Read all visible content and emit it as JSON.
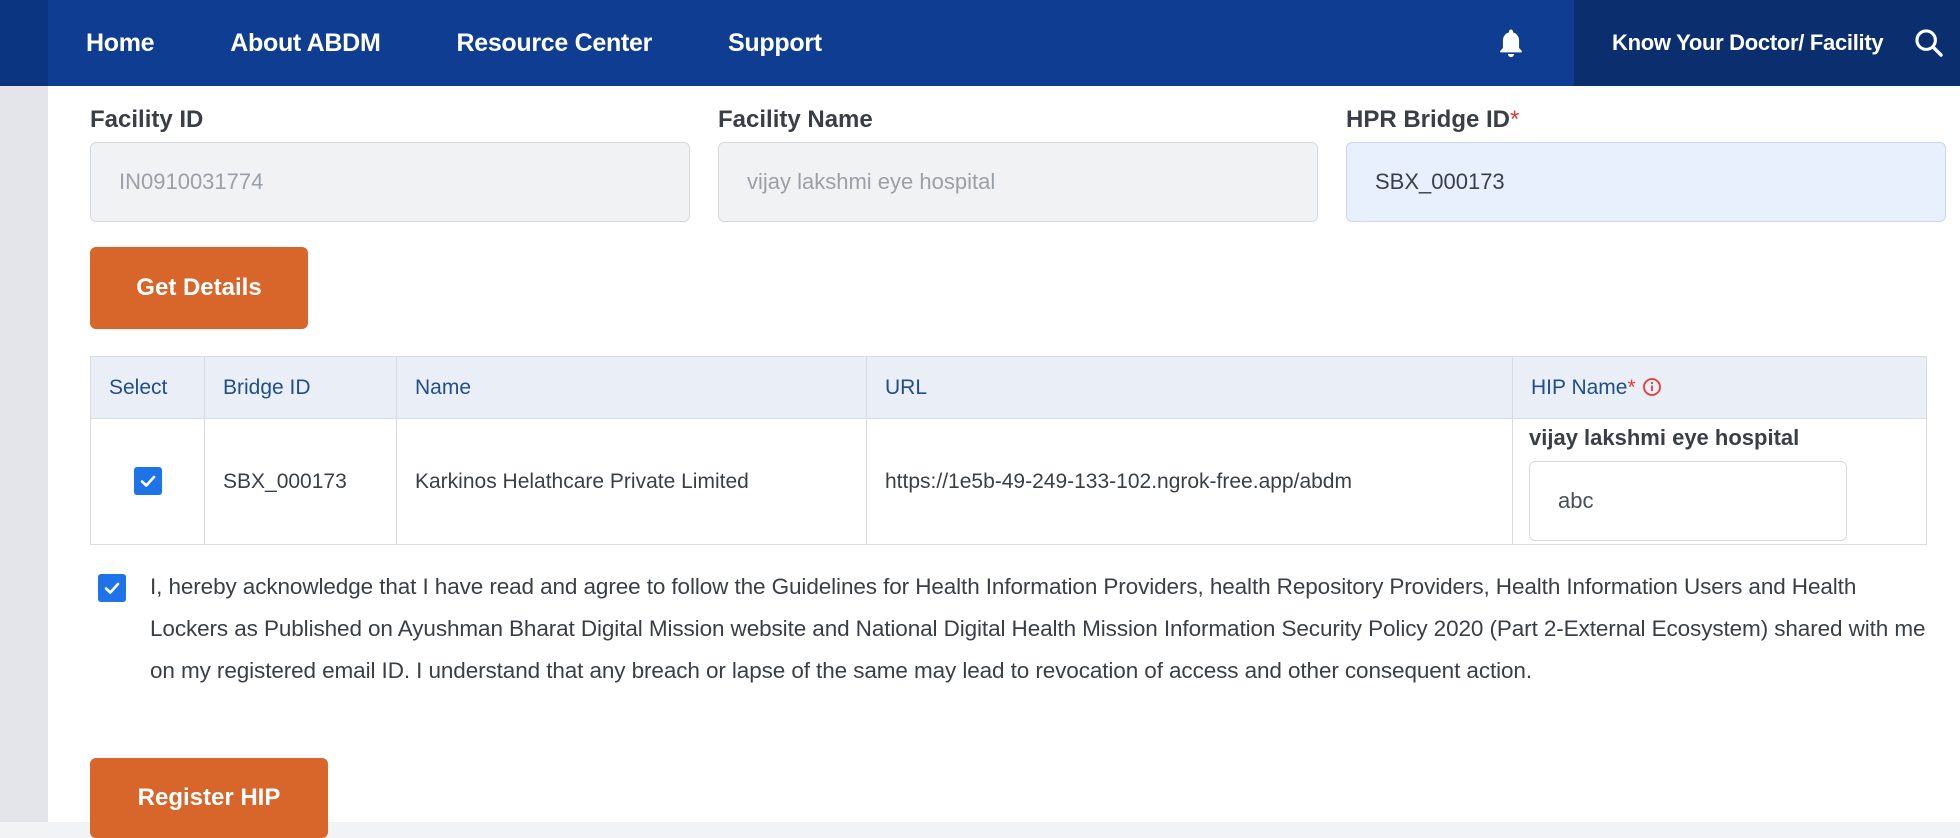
{
  "nav": {
    "items": [
      "Home",
      "About ABDM",
      "Resource Center",
      "Support"
    ],
    "know_label": "Know Your Doctor/ Facility",
    "bell_icon": "bell-icon",
    "search_icon": "search-icon"
  },
  "form": {
    "facility_id_label": "Facility ID",
    "facility_id_value": "IN0910031774",
    "facility_name_label": "Facility Name",
    "facility_name_value": "vijay lakshmi eye hospital",
    "bridge_id_label": "HPR Bridge ID",
    "bridge_id_required": "*",
    "bridge_id_value": "SBX_000173",
    "get_details_label": "Get Details"
  },
  "table": {
    "headers": [
      "Select",
      "Bridge ID",
      "Name",
      "URL",
      "HIP Name"
    ],
    "hip_required": "*",
    "row": {
      "selected": true,
      "bridge_id": "SBX_000173",
      "name": "Karkinos Helathcare Private Limited",
      "url": "https://1e5b-49-249-133-102.ngrok-free.app/abdm",
      "hip_name": "vijay lakshmi eye hospital",
      "hip_input": "abc"
    }
  },
  "ack": {
    "checked": true,
    "text": "I, hereby acknowledge that I have read and agree to follow the Guidelines for Health Information Providers, health Repository Providers, Health Information Users and Health Lockers as Published on Ayushman Bharat Digital Mission website and National Digital Health Mission Information Security Policy 2020 (Part 2-External Ecosystem) shared with me on my registered email ID. I understand that any breach or lapse of the same may lead to revocation of access and other consequent action."
  },
  "register_label": "Register HIP",
  "colors": {
    "nav": "#0e3d91",
    "accent": "#d8652a",
    "checkbox": "#1e73e8"
  }
}
